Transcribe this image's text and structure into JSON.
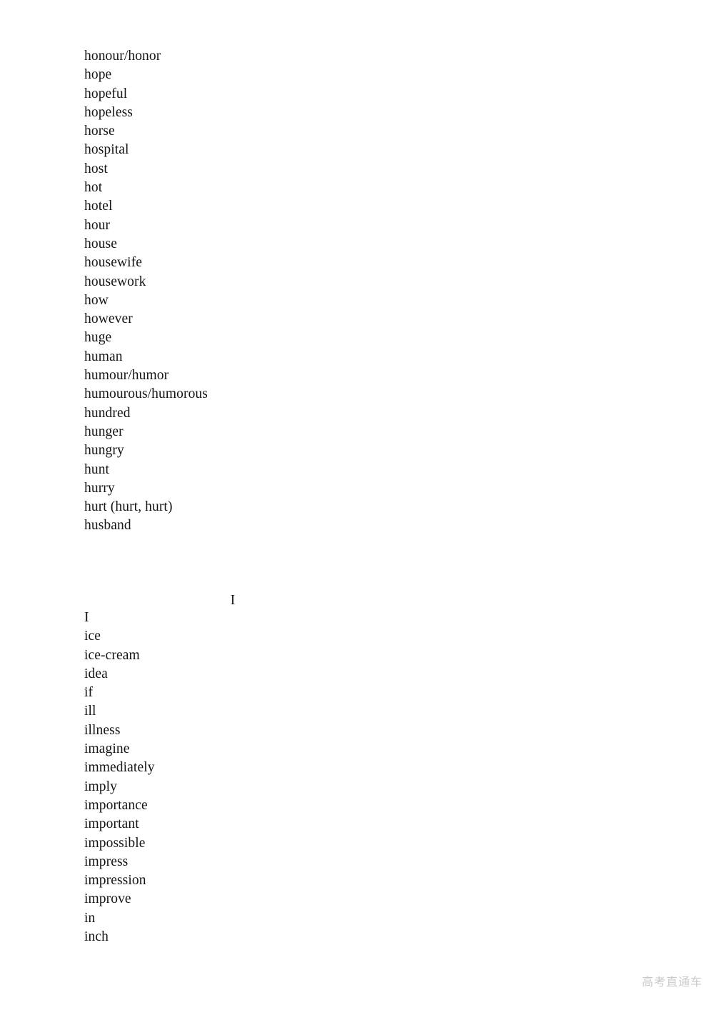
{
  "document": {
    "type": "vocabulary-word-list",
    "background_color": "#ffffff",
    "text_color": "#141414"
  },
  "sections": [
    {
      "id": "h",
      "heading": null,
      "words": [
        "honour/honor",
        "hope",
        "hopeful",
        "hopeless",
        "horse",
        "hospital",
        "host",
        "hot",
        "hotel",
        "hour",
        "house",
        "housewife",
        "housework",
        "how",
        "however",
        "huge",
        "human",
        "humour/humor",
        "humourous/humorous",
        "hundred",
        "hunger",
        "hungry",
        "hunt",
        "hurry",
        "hurt (hurt, hurt)",
        "husband"
      ]
    },
    {
      "id": "i",
      "heading": "I",
      "words": [
        "I",
        "ice",
        "ice-cream",
        "idea",
        "if",
        "ill",
        "illness",
        "imagine",
        "immediately",
        "imply",
        "importance",
        "important",
        "impossible",
        "impress",
        "impression",
        "improve",
        "in",
        "inch"
      ]
    }
  ],
  "watermark": {
    "text": "高考直通车",
    "color": "#c9c9c9"
  }
}
